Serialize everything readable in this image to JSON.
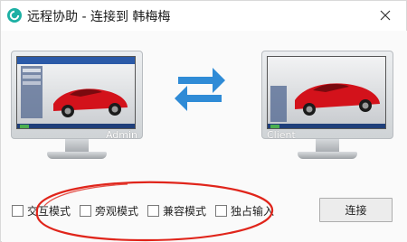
{
  "window": {
    "title": "远程协助 - 连接到 韩梅梅",
    "accent": "#1cb0a4"
  },
  "monitors": {
    "left": {
      "label": "Admin"
    },
    "right": {
      "label": "Client"
    }
  },
  "arrows": {
    "color": "#2f8bd6"
  },
  "options": [
    {
      "label": "交互模式",
      "checked": false
    },
    {
      "label": "旁观模式",
      "checked": false
    },
    {
      "label": "兼容模式",
      "checked": false
    },
    {
      "label": "独占输入",
      "checked": false
    }
  ],
  "connect_button": {
    "label": "连接"
  },
  "annotation_color": "#e0251b"
}
